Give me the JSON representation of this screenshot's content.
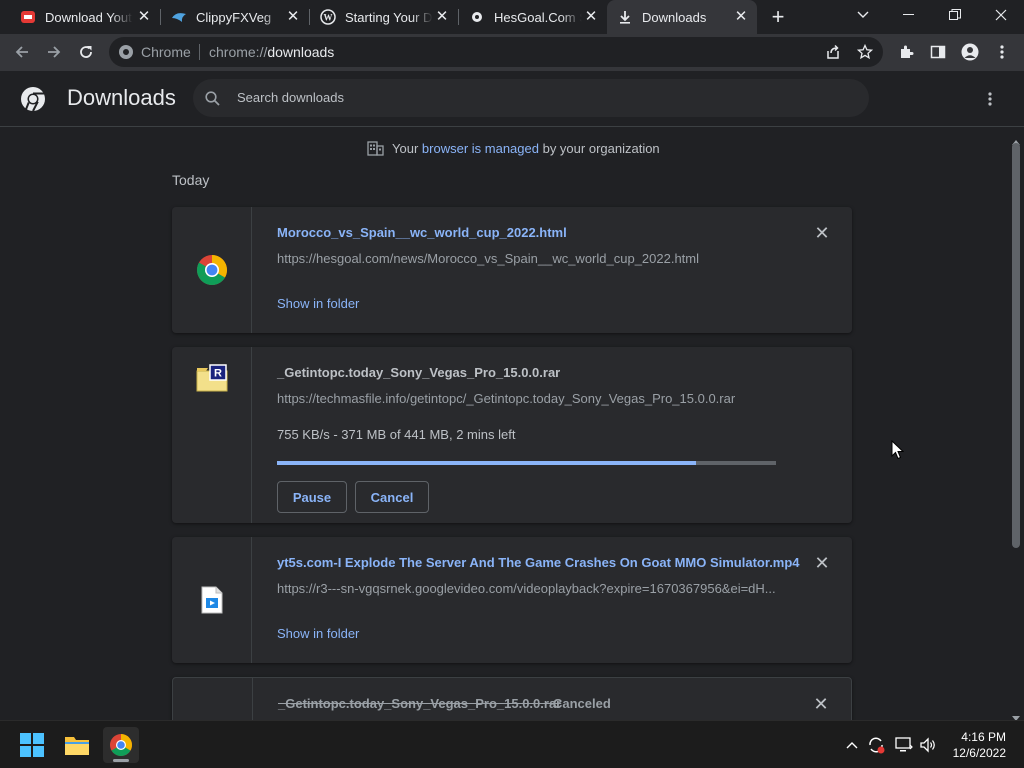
{
  "tabs": [
    {
      "title": "Download Youtube",
      "favicon": "youtube-downloader-icon",
      "active": false
    },
    {
      "title": "ClippyFXVeg",
      "favicon": "clippyfx-icon",
      "active": false
    },
    {
      "title": "Starting Your Download",
      "favicon": "wordpress-icon",
      "active": false
    },
    {
      "title": "HesGoal.Com Sports",
      "favicon": "hesgoal-icon",
      "active": false
    },
    {
      "title": "Downloads",
      "favicon": "download-icon",
      "active": true
    }
  ],
  "new_tab_symbol": "+",
  "omnibox": {
    "site": "Chrome",
    "url_prefix": "chrome://",
    "url_path": "downloads"
  },
  "page": {
    "title": "Downloads",
    "search_placeholder": "Search downloads",
    "managed_pre": "Your",
    "managed_link": "browser is managed",
    "managed_post": "by your organization",
    "section_label": "Today"
  },
  "downloads": [
    {
      "filename": "Morocco_vs_Spain__wc_world_cup_2022.html",
      "url": "https://hesgoal.com/news/Morocco_vs_Spain__wc_world_cup_2022.html",
      "action": "Show in folder",
      "icon": "chrome-html-file-icon"
    },
    {
      "filename": "_Getintopc.today_Sony_Vegas_Pro_15.0.0.rar",
      "url": "https://techmasfile.info/getintopc/_Getintopc.today_Sony_Vegas_Pro_15.0.0.rar",
      "status": "755 KB/s - 371 MB of 441 MB, 2 mins left",
      "progress": 0.84,
      "pause_label": "Pause",
      "cancel_label": "Cancel",
      "icon": "rar-archive-icon"
    },
    {
      "filename": "yt5s.com-I Explode The Server And The Game Crashes On Goat MMO Simulator.mp4",
      "url": "https://r3---sn-vgqsrnek.googlevideo.com/videoplayback?expire=1670367956&ei=dH...",
      "action": "Show in folder",
      "icon": "video-file-icon"
    },
    {
      "filename": "_Getintopc.today_Sony_Vegas_Pro_15.0.0.rar",
      "status": "Canceled",
      "icon": "rar-archive-icon"
    }
  ],
  "taskbar": {
    "apps": [
      "start-icon",
      "file-explorer-icon",
      "chrome-icon"
    ],
    "time": "4:16 PM",
    "date": "12/6/2022"
  },
  "colors": {
    "accent": "#8ab4f8",
    "background": "#202124",
    "card": "#292a2d",
    "toolbar": "#35363a"
  }
}
